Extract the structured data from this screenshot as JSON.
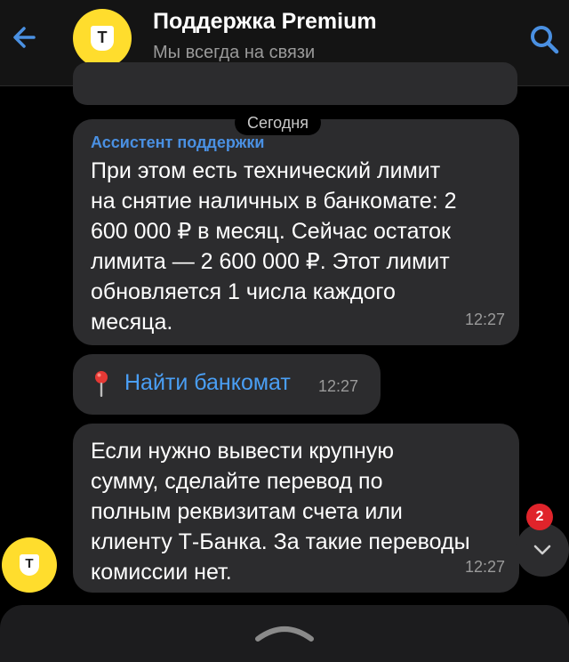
{
  "header": {
    "title": "Поддержка Premium",
    "subtitle": "Мы всегда на связи",
    "logo_glyph": "T",
    "back_icon": "arrow-left-icon",
    "search_icon": "search-icon"
  },
  "chat": {
    "date_label": "Сегодня",
    "messages": [
      {
        "sender": "Ассистент поддержки",
        "lines": [
          "При этом есть технический лимит",
          "на снятие наличных в банкомате: 2",
          "600 000 ₽ в месяц. Сейчас остаток",
          "лимита — 2 600 000 ₽. Этот лимит",
          "обновляется 1 числа каждого",
          "месяца."
        ],
        "time": "12:27"
      },
      {
        "link_text": "Найти банкомат",
        "icon": "pin-icon",
        "time": "12:27"
      },
      {
        "lines": [
          "Если нужно вывести крупную",
          "сумму, сделайте перевод по",
          "полным реквизитам счета или",
          "клиенту Т-Банка. За такие переводы",
          "комиссии нет."
        ],
        "time": "12:27"
      }
    ],
    "avatar_glyph": "T",
    "unread_count": "2"
  },
  "colors": {
    "accent": "#4a90e2",
    "brand_yellow": "#ffdd2d",
    "bubble": "#2c2c2e",
    "badge": "#e0242b"
  }
}
